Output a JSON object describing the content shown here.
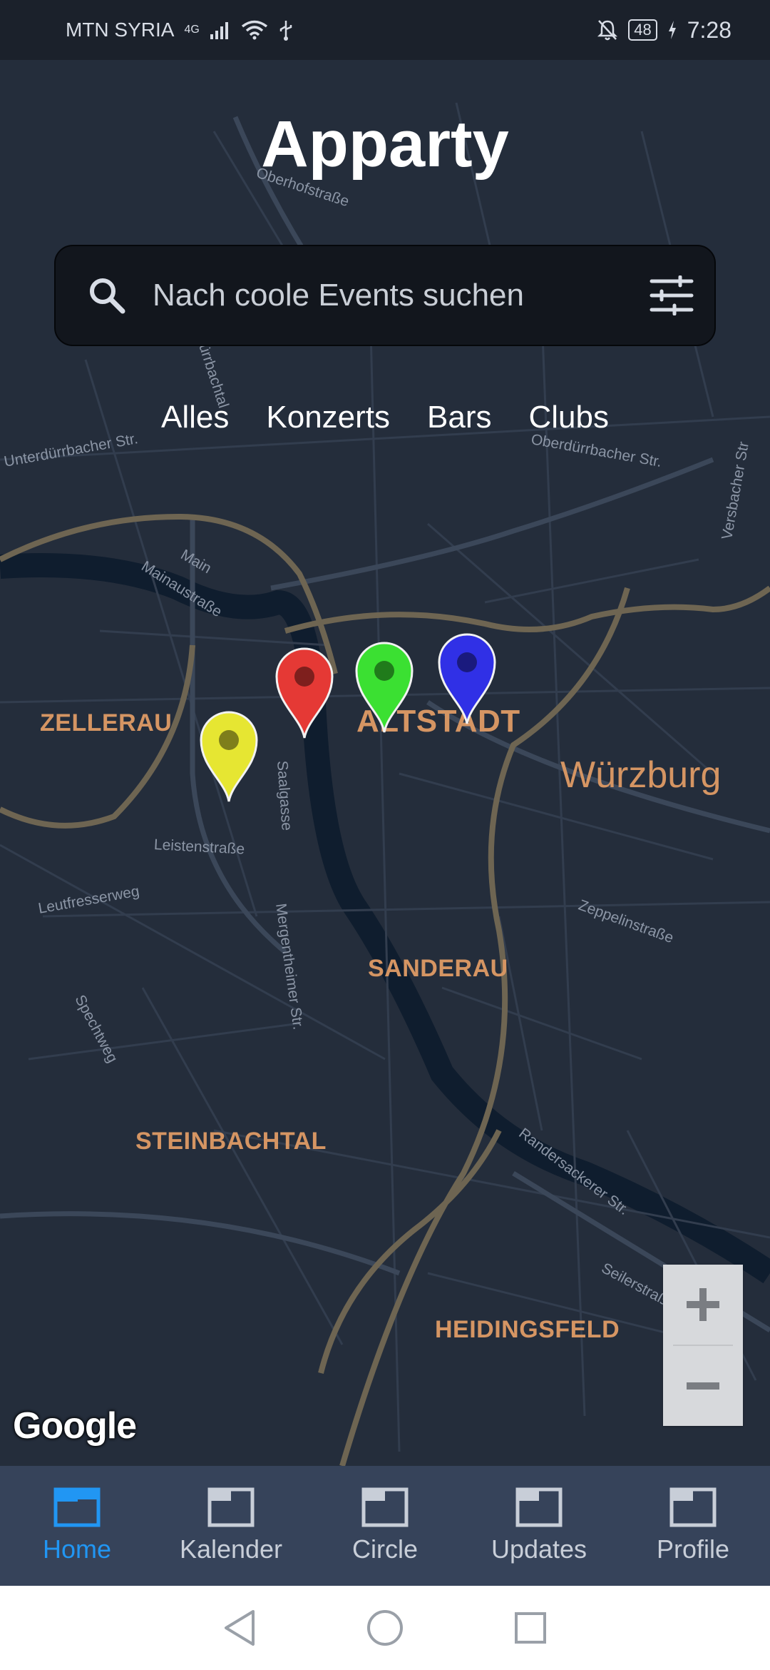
{
  "status_bar": {
    "carrier": "MTN SYRIA",
    "network": "4G",
    "battery": "48",
    "time": "7:28"
  },
  "app": {
    "title": "Apparty"
  },
  "search": {
    "placeholder": "Nach coole Events suchen"
  },
  "tabs": [
    {
      "label": "Alles"
    },
    {
      "label": "Konzerts"
    },
    {
      "label": "Bars"
    },
    {
      "label": "Clubs"
    }
  ],
  "map": {
    "districts": [
      "ZELLERAU",
      "ALTSTADT",
      "SANDERAU",
      "STEINBACHTAL",
      "HEIDINGSFELD"
    ],
    "city": "Würzburg",
    "streets": [
      "Oberhofstraße",
      "Dürrbachtal",
      "Unterdürrbacher Str.",
      "Oberdürrbacher Str.",
      "Versbacher Str",
      "Main",
      "Mainaustraße",
      "Saalgasse",
      "Leistenstraße",
      "Leutfresserweg",
      "Mergentheimer Str.",
      "Zeppelinstraße",
      "Spechtweg",
      "Randersackerer Str.",
      "Seilerstraße"
    ],
    "attribution": "Google",
    "pins": [
      {
        "color": "#e6e632",
        "name": "yellow-pin"
      },
      {
        "color": "#e53935",
        "name": "red-pin"
      },
      {
        "color": "#3be032",
        "name": "green-pin"
      },
      {
        "color": "#3030e6",
        "name": "blue-pin"
      }
    ]
  },
  "zoom": {
    "in": "+",
    "out": "−"
  },
  "bottom_nav": [
    {
      "label": "Home",
      "active": true
    },
    {
      "label": "Kalender",
      "active": false
    },
    {
      "label": "Circle",
      "active": false
    },
    {
      "label": "Updates",
      "active": false
    },
    {
      "label": "Profile",
      "active": false
    }
  ],
  "colors": {
    "accent": "#2196f3",
    "map_label": "#d59563",
    "map_bg": "#242d3b",
    "nav_bg": "#36435a"
  }
}
